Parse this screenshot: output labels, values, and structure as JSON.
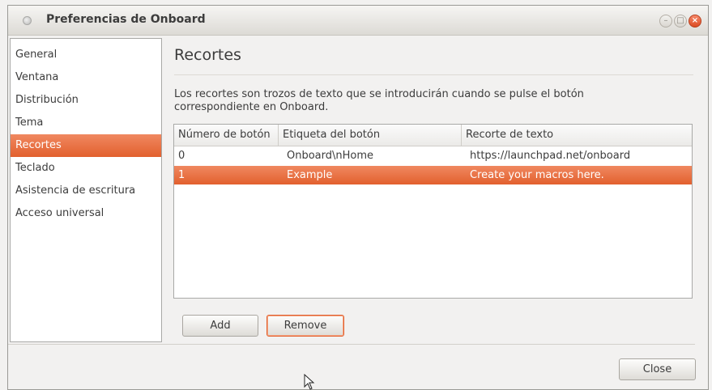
{
  "window": {
    "title": "Preferencias de Onboard",
    "controls": {
      "minimize": "–",
      "maximize": "□",
      "close": "×"
    }
  },
  "sidebar": {
    "items": [
      {
        "label": "General",
        "selected": false
      },
      {
        "label": "Ventana",
        "selected": false
      },
      {
        "label": "Distribución",
        "selected": false
      },
      {
        "label": "Tema",
        "selected": false
      },
      {
        "label": "Recortes",
        "selected": true
      },
      {
        "label": "Teclado",
        "selected": false
      },
      {
        "label": "Asistencia de escritura",
        "selected": false
      },
      {
        "label": "Acceso universal",
        "selected": false
      }
    ]
  },
  "main": {
    "heading": "Recortes",
    "description": "Los recortes son trozos de texto que se introducirán cuando se pulse el botón correspondiente en Onboard.",
    "table": {
      "columns": [
        "Número de botón",
        "Etiqueta del botón",
        "Recorte de texto"
      ],
      "rows": [
        {
          "button": "0",
          "label": "Onboard\\nHome",
          "snippet": "https://launchpad.net/onboard",
          "selected": false
        },
        {
          "button": "1",
          "label": "Example",
          "snippet": "Create your macros here.",
          "selected": true
        }
      ]
    },
    "add_label": "Add",
    "remove_label": "Remove"
  },
  "footer": {
    "close_label": "Close"
  },
  "colors": {
    "accent": "#e2602e",
    "background": "#f2f1f0"
  }
}
